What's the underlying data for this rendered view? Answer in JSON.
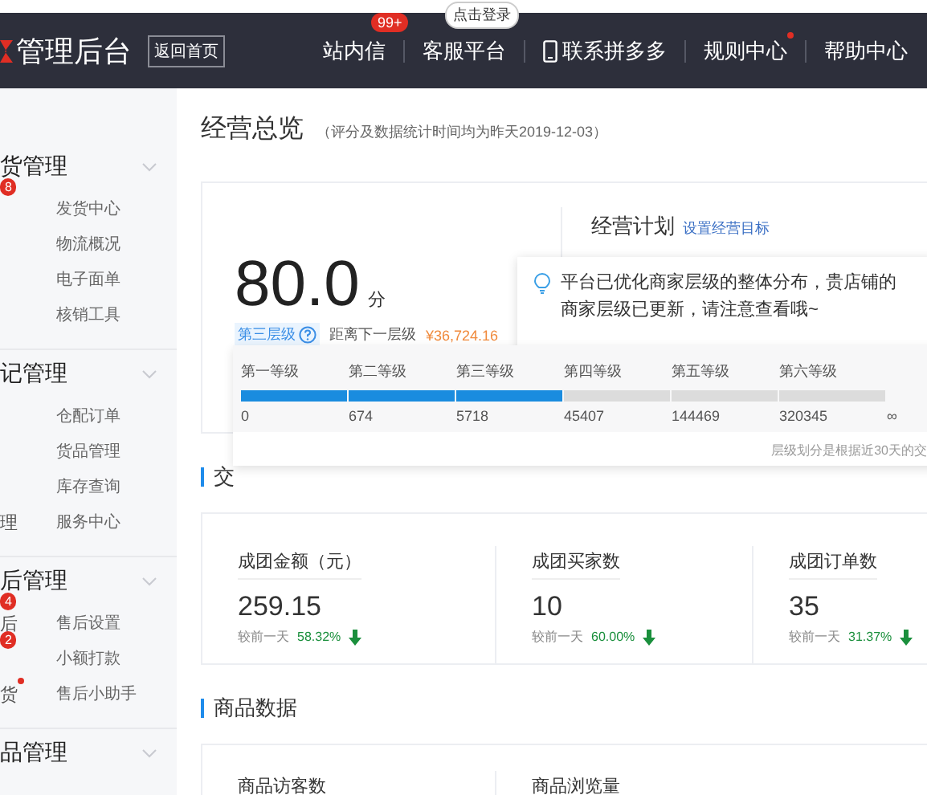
{
  "header": {
    "logo": "管理后台",
    "home_button": "返回首页",
    "login_bubble": "点击登录",
    "nav": [
      {
        "label": "站内信",
        "kind": "badge",
        "badge": "99+"
      },
      {
        "label": "客服平台",
        "kind": "plain"
      },
      {
        "label": "联系拼多多",
        "kind": "phone"
      },
      {
        "label": "规则中心",
        "kind": "dot"
      },
      {
        "label": "帮助中心",
        "kind": "plain"
      }
    ]
  },
  "sidebar": [
    {
      "title": "货管理",
      "badge": "8",
      "rows": [
        {
          "right": "发货中心"
        },
        {
          "right": "物流概况"
        },
        {
          "right": "电子面单"
        },
        {
          "right": "核销工具"
        }
      ]
    },
    {
      "title": "记管理",
      "rows": [
        {
          "right": "仓配订单"
        },
        {
          "right": "货品管理"
        },
        {
          "right": "库存查询"
        },
        {
          "left": "理",
          "right": "服务中心"
        }
      ]
    },
    {
      "title": "后管理",
      "badge": "4",
      "rows": [
        {
          "left": "后",
          "left_badge": "2",
          "right": "售后设置"
        },
        {
          "right": "小额打款"
        },
        {
          "left": "货",
          "left_dot": true,
          "right": "售后小助手"
        }
      ]
    },
    {
      "title": "品管理"
    }
  ],
  "overview": {
    "title": "经营总览",
    "note": "（评分及数据统计时间均为昨天2019-12-03）",
    "score": "80.0",
    "unit": "分",
    "tier": "第三层级",
    "gap_label": "距离下一层级",
    "gap_value": "¥36,724.16",
    "plan_title": "经营计划",
    "plan_link": "设置经营目标"
  },
  "tip": "平台已优化商家层级的整体分布，贵店铺的商家层级已更新，请注意查看哦~",
  "levels": {
    "tiers": [
      {
        "label": "第一等级",
        "reached": true
      },
      {
        "label": "第二等级",
        "reached": true
      },
      {
        "label": "第三等级",
        "reached": true
      },
      {
        "label": "第四等级",
        "reached": false
      },
      {
        "label": "第五等级",
        "reached": false
      },
      {
        "label": "第六等级",
        "reached": false
      }
    ],
    "thresholds": [
      "0",
      "674",
      "5718",
      "45407",
      "144469",
      "320345",
      "∞"
    ],
    "footnote": "层级划分是根据近30天的交"
  },
  "trade_heading": "交",
  "stats": [
    {
      "title": "成团金额（元）",
      "value": "259.15",
      "compare": "较前一天",
      "change": "58.32%",
      "down": true
    },
    {
      "title": "成团买家数",
      "value": "10",
      "compare": "较前一天",
      "change": "60.00%",
      "down": true
    },
    {
      "title": "成团订单数",
      "value": "35",
      "compare": "较前一天",
      "change": "31.37%",
      "down": true
    }
  ],
  "goods_heading": "商品数据",
  "goods": [
    {
      "title": "商品访客数"
    },
    {
      "title": "商品浏览量"
    }
  ]
}
